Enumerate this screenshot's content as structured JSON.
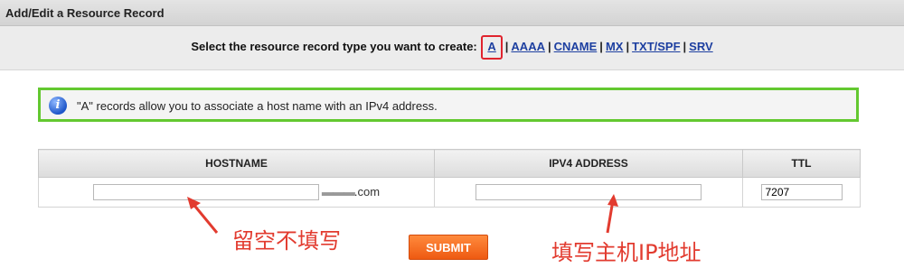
{
  "window": {
    "title": "Add/Edit a Resource Record"
  },
  "type_selector": {
    "prompt": "Select the resource record type you want to create:",
    "types": [
      "A",
      "AAAA",
      "CNAME",
      "MX",
      "TXT/SPF",
      "SRV"
    ],
    "selected": "A",
    "separator": "|"
  },
  "info_box": {
    "icon": "info-icon",
    "message": "\"A\" records allow you to associate a host name with an IPv4 address."
  },
  "table": {
    "headers": [
      "HOSTNAME",
      "IPV4 ADDRESS",
      "TTL"
    ],
    "hostname_value": "",
    "hostname_domain_masked": "▬▬▬",
    "hostname_domain_suffix": ".com",
    "ipv4_value": "",
    "ttl_value": "7207"
  },
  "submit_label": "SUBMIT",
  "annotations": {
    "left": "留空不填写",
    "right": "填写主机IP地址"
  },
  "colors": {
    "highlight_box": "#e0242e",
    "info_border": "#63c830",
    "submit": "#ee5a12",
    "annotation": "#e23b2f",
    "link": "#1d3fa0"
  }
}
